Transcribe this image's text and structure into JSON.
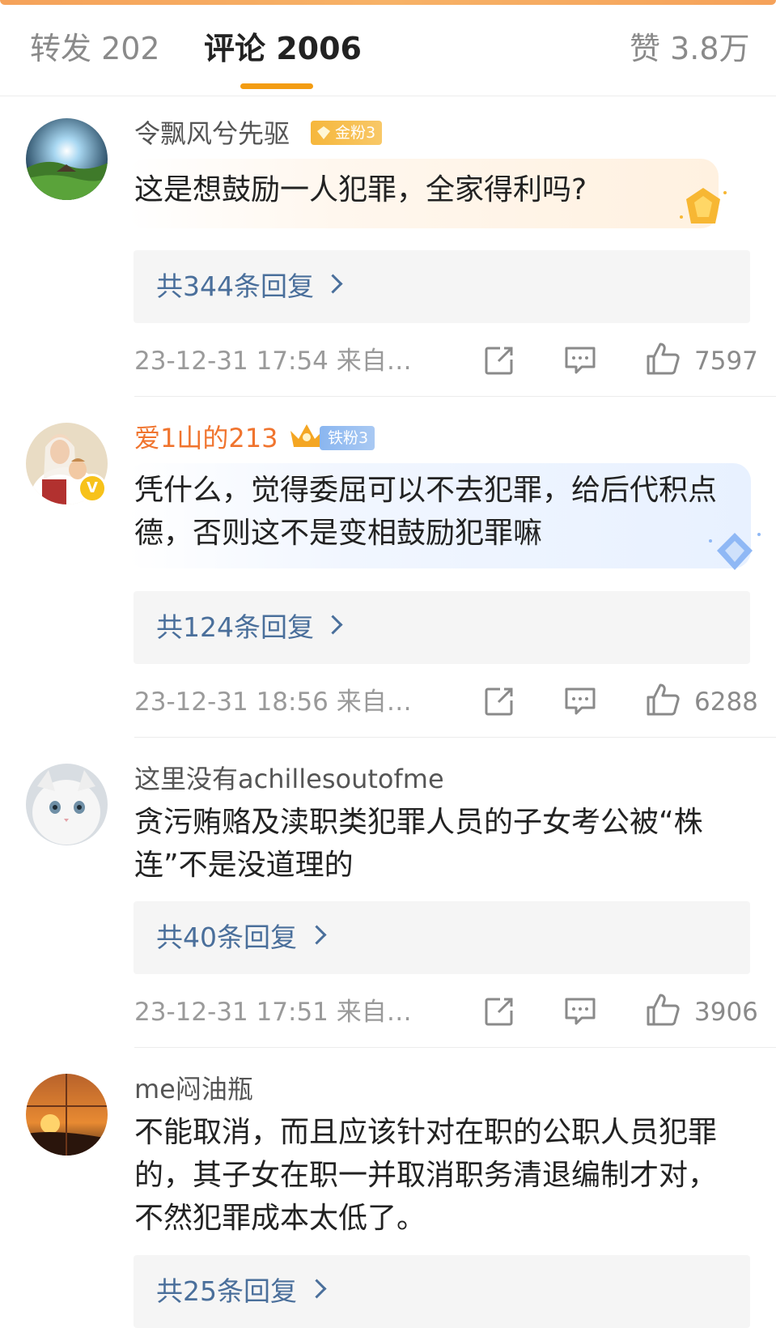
{
  "tabs": {
    "repost": "转发 202",
    "comments": "评论 2006",
    "likes": "赞 3.8万"
  },
  "colors": {
    "accent": "#f39c12",
    "link": "#4a6f9b",
    "vip_name": "#f0742e"
  },
  "comments": [
    {
      "username": "令飘风兮先驱",
      "badge": "金粉3",
      "text": "这是想鼓励一人犯罪，全家得利吗?",
      "replies": "共344条回复",
      "time": "23-12-31 17:54 来自…",
      "likes": "7597",
      "avatar_icon": "landscape-avatar"
    },
    {
      "username": "爱1山的213",
      "badge": "铁粉3",
      "verified": true,
      "text": "凭什么，觉得委屈可以不去犯罪，给后代积点德，否则这不是变相鼓励犯罪嘛",
      "replies": "共124条回复",
      "time": "23-12-31 18:56 来自…",
      "likes": "6288",
      "avatar_icon": "painting-avatar"
    },
    {
      "username": "这里没有achillesoutofme",
      "text": "贪污贿赂及渎职类犯罪人员的子女考公被“株连”不是没道理的",
      "replies": "共40条回复",
      "time": "23-12-31 17:51 来自…",
      "likes": "3906",
      "avatar_icon": "cat-avatar"
    },
    {
      "username": "me闷油瓶",
      "text": "不能取消，而且应该针对在职的公职人员犯罪的，其子女在职一并取消职务清退编制才对，不然犯罪成本太低了。",
      "replies": "共25条回复",
      "avatar_icon": "sunset-avatar"
    }
  ]
}
